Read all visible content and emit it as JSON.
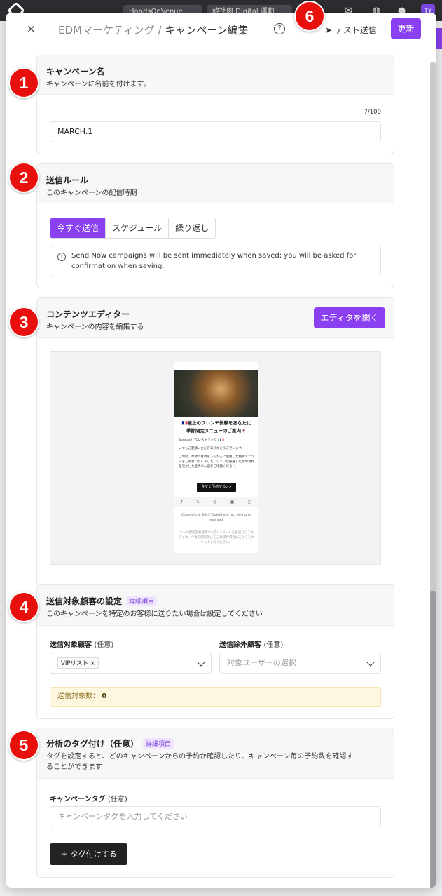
{
  "topbar": {
    "chips": [
      "HandsOnVenue",
      "韓社肉 Digital 運動"
    ],
    "avatar": "TY"
  },
  "header": {
    "close": "×",
    "crumb_parent": "EDMマーケティング /",
    "crumb_current": "キャンペーン編集",
    "help": "?",
    "test_send": "テスト送信",
    "update": "更新"
  },
  "campaign_name": {
    "title": "キャンペーン名",
    "subtitle": "キャンペーンに名前を付けます。",
    "counter": "7/100",
    "value": "MARCH.1"
  },
  "send_rule": {
    "title": "送信ルール",
    "subtitle": "このキャンペーンの配信時期",
    "options": [
      "今すぐ送信",
      "スケジュール",
      "繰り返し"
    ],
    "selected_index": 0,
    "info": "Send Now campaigns will be sent immediately when saved; you will be asked for confirmation when saving."
  },
  "content_editor": {
    "title": "コンテンツエディター",
    "subtitle": "キャンペーンの内容を編集する",
    "open_button": "エディタを開く",
    "preview": {
      "heading_line1": "🇫🇷極上のフレンチ体験をあなたに",
      "heading_line2": "季節限定メニューのご案内🍷",
      "greeting": "Bonjour！TCレストランです🇫🇷",
      "thanks": "いつもご愛顧いただきありがとうございます。",
      "body": "この度、季節の食材をふんだんに使用した特別メニューをご用意いたしました。シェフが厳選した旬の食材を活かした至高の一皿をご堪能ください。",
      "cta": "今すぐ予約する>>",
      "social": [
        "f",
        "𝕏",
        "◎",
        "▣",
        "▢"
      ],
      "copyright": "Copyright © 2025 TableCheck Inc., All rights reserved.",
      "footer_note": "メール配信を希望頂いた方にEメールをお送りしております。今後の配信停止をご希望の場合はこちらをクリックしてください。"
    }
  },
  "audience": {
    "title": "送信対象顧客の設定",
    "badge": "詳細項目",
    "subtitle": "このキャンペーンを特定のお客様に送りたい場合は設定してください",
    "target_label": "送信対象顧客",
    "target_optional": "(任意)",
    "target_chip": "VIPリスト",
    "exclude_label": "送信除外顧客",
    "exclude_optional": "(任意)",
    "exclude_placeholder": "対象ユーザーの選択",
    "count_label": "送信対象数：",
    "count_value": "0"
  },
  "tagging": {
    "title": "分析のタグ付け（任意）",
    "badge": "詳細項目",
    "subtitle": "タグを設定すると、どのキャンペーンからの予約か確認したり、キャンペーン毎の予約数を確認することができます",
    "field_label": "キャンペーンタグ",
    "field_optional": "(任意)",
    "placeholder": "キャンペーンタグを入力してください",
    "add_button": "＋ タグ付けする"
  },
  "markers": [
    "1",
    "2",
    "3",
    "4",
    "5",
    "6"
  ],
  "colors": {
    "accent": "#8a3ff0",
    "marker": "#e8100d"
  }
}
